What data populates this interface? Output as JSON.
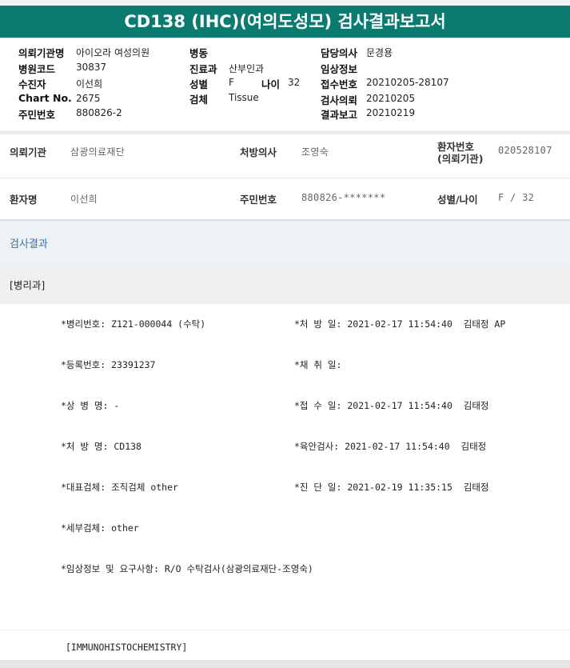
{
  "title": "CD138 (IHC)(여의도성모) 검사결과보고서",
  "header": {
    "clinic_label": "의뢰기관명",
    "clinic_value": "아이오라 여성의원",
    "code_label": "병원코드",
    "code_value": "30837",
    "examinee_label": "수진자",
    "examinee_value": "이선희",
    "chart_label": "Chart No.",
    "chart_value": "2675",
    "rrn_label": "주민번호",
    "rrn_value": "880826-2",
    "ward_label": "병동",
    "ward_value": "",
    "dept_label": "진료과",
    "dept_value": "산부인과",
    "sex_label": "성별",
    "sex_value": "F",
    "age_label": "나이",
    "age_value": "32",
    "specimen_label": "검체",
    "specimen_value": "Tissue",
    "doctor_label": "담당의사",
    "doctor_value": "문경용",
    "clinical_label": "임상정보",
    "clinical_value": "",
    "receipt_label": "접수번호",
    "receipt_value": "20210205-28107",
    "request_label": "검사의뢰",
    "request_value": "20210205",
    "report_label": "결과보고",
    "report_value": "20210219"
  },
  "info": {
    "inst_label": "의뢰기관",
    "inst_value": "삼광의료재단",
    "prescriber_label": "처방의사",
    "prescriber_value": "조영숙",
    "patno_label_1": "환자번호",
    "patno_label_2": "(의뢰기관)",
    "patno_value": "020528107",
    "patient_label": "환자명",
    "patient_value": "이선희",
    "rrn_label": "주민번호",
    "rrn_value": "880826-*******",
    "sexage_label": "성별/나이",
    "sexage_value": "F / 32"
  },
  "section": {
    "results_label": "검사결과",
    "path_label": "[병리과]"
  },
  "details": {
    "r1_left": "*병리번호: Z121-000044 (수탁)",
    "r1_right": "*처 방 일: 2021-02-17 11:54:40  김태정 AP",
    "r2_left": "*등록번호: 23391237",
    "r2_right": "*채 취 일:",
    "r3_left": "*상 병 명: -",
    "r3_right": "*접 수 일: 2021-02-17 11:54:40  김태정",
    "r4_left": "*처 방 명: CD138",
    "r4_right": "*육안검사: 2021-02-17 11:54:40  김태정",
    "r5_left": "*대표검체: 조직검체 other",
    "r5_right": "*진 단 일: 2021-02-19 11:35:15  김태정",
    "r6_left": "*세부검체: other",
    "r7_left": "*임상정보 및 요구사항: R/O 수탁검사(삼광의료재단-조영숙)",
    "r8_text": "[IMMUNOHISTOCHEMISTRY]"
  },
  "colors": {
    "title_bg": "#0b7b70",
    "section_bg": "#edf2f7",
    "section_text": "#3a6fa8"
  }
}
